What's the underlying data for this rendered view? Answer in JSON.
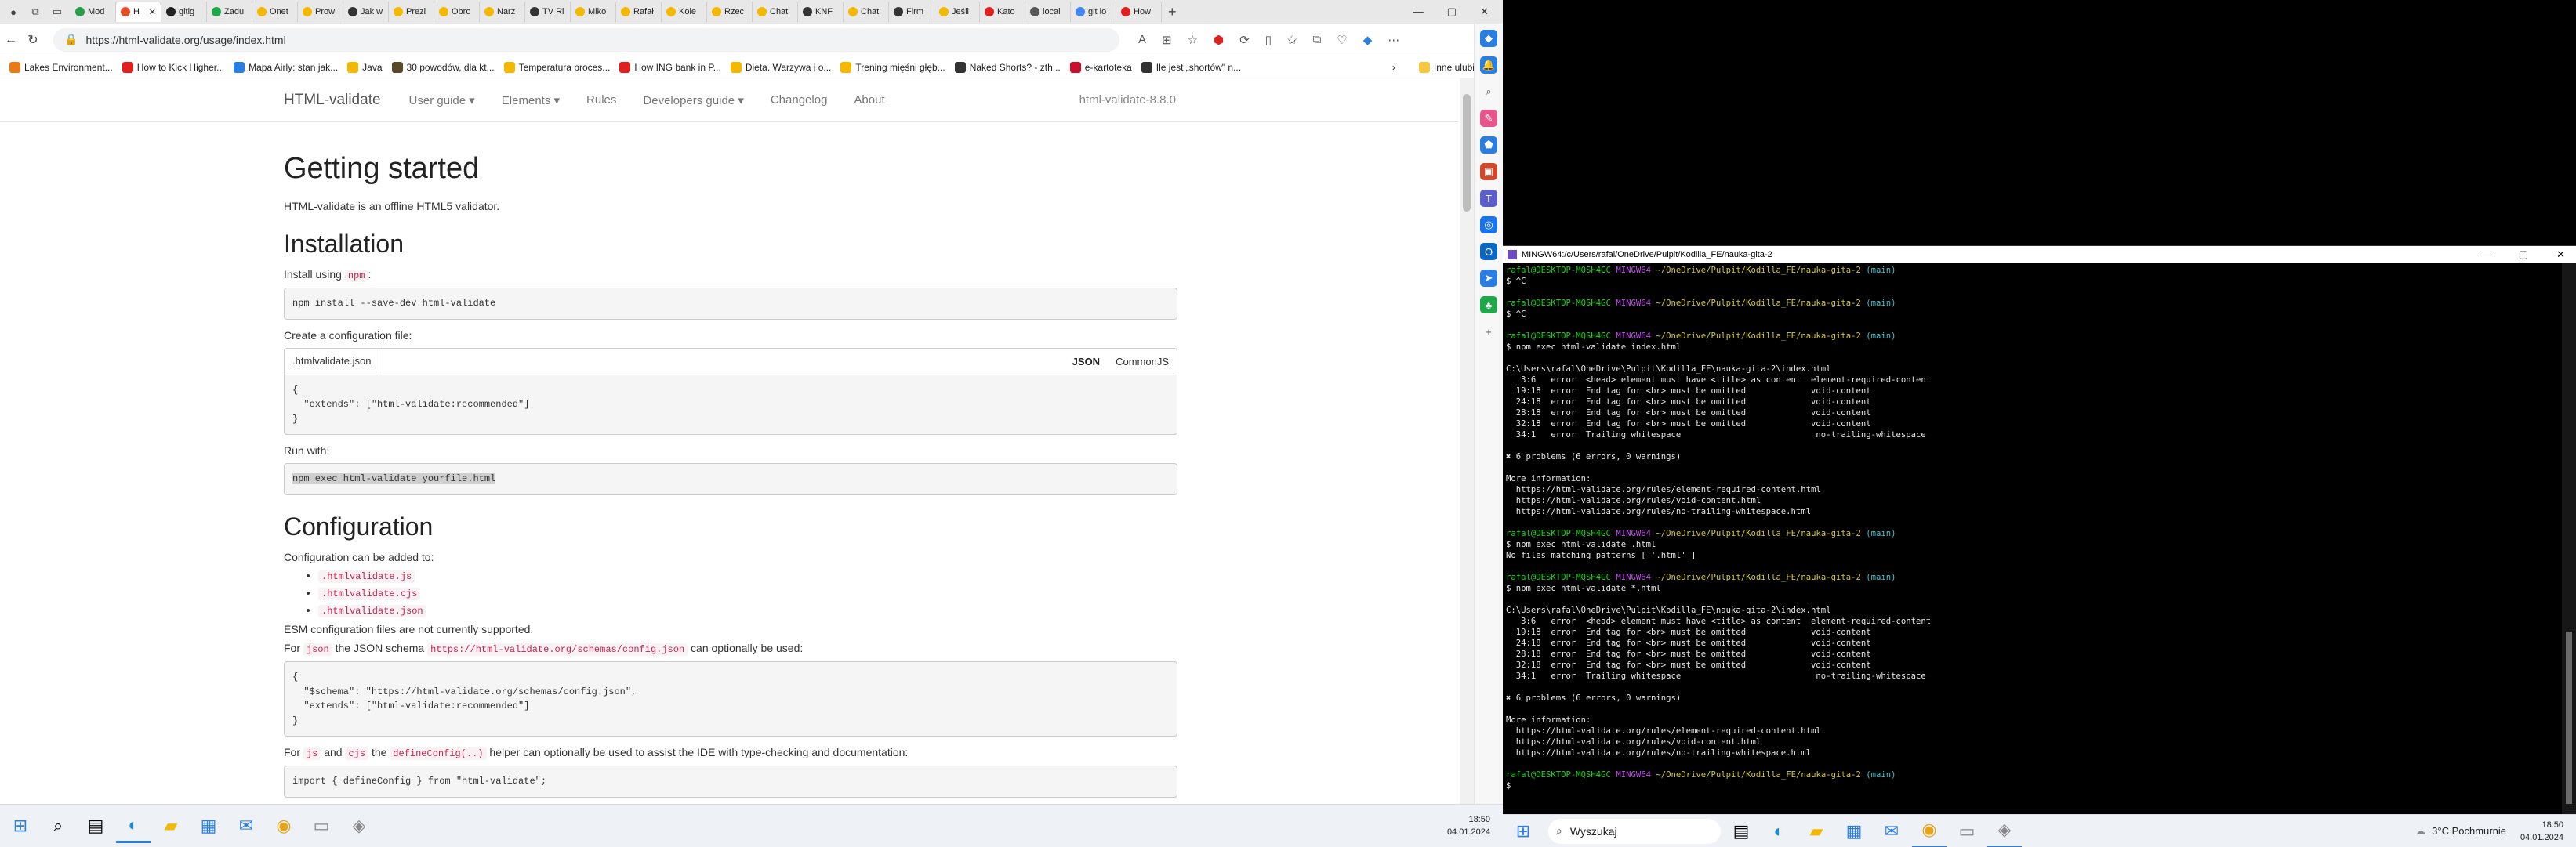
{
  "browser": {
    "tabs": [
      {
        "label": "Mod",
        "color": "#2a9d4a"
      },
      {
        "label": "H",
        "color": "#e44d26",
        "active": true
      },
      {
        "label": "gitig",
        "color": "#222"
      },
      {
        "label": "Zadu",
        "color": "#1fa84a"
      },
      {
        "label": "Onet",
        "color": "#f5b800"
      },
      {
        "label": "Prow",
        "color": "#f5b800"
      },
      {
        "label": "Jak w",
        "color": "#333"
      },
      {
        "label": "Prezi",
        "color": "#f5b800"
      },
      {
        "label": "Obro",
        "color": "#f5b800"
      },
      {
        "label": "Narz",
        "color": "#f5b800"
      },
      {
        "label": "TV Ri",
        "color": "#333"
      },
      {
        "label": "Miko",
        "color": "#f5b800"
      },
      {
        "label": "Rafał",
        "color": "#f5b800"
      },
      {
        "label": "Kole",
        "color": "#f5b800"
      },
      {
        "label": "Rzec",
        "color": "#f5b800"
      },
      {
        "label": "Chat",
        "color": "#f5b800"
      },
      {
        "label": "KNF",
        "color": "#333"
      },
      {
        "label": "Chat",
        "color": "#f5b800"
      },
      {
        "label": "Firm",
        "color": "#333"
      },
      {
        "label": "Jeśli",
        "color": "#f5b800"
      },
      {
        "label": "Kato",
        "color": "#e21f1f"
      },
      {
        "label": "local",
        "color": "#555"
      },
      {
        "label": "git lo",
        "color": "#4285f4"
      },
      {
        "label": "How",
        "color": "#e21f1f"
      }
    ],
    "new_tab_symbol": "+",
    "window_buttons": [
      "—",
      "▢",
      "✕"
    ],
    "url": "https://html-validate.org/usage/index.html",
    "bookmarks": [
      {
        "label": "Lakes Environment...",
        "color": "#e87b16"
      },
      {
        "label": "How to Kick Higher...",
        "color": "#e21f1f"
      },
      {
        "label": "Mapa Airly: stan jak...",
        "color": "#2a7de1"
      },
      {
        "label": "Java",
        "color": "#f5b800"
      },
      {
        "label": "30 powodów, dla kt...",
        "color": "#5a4a2a"
      },
      {
        "label": "Temperatura proces...",
        "color": "#f5b800"
      },
      {
        "label": "How ING bank in P...",
        "color": "#e21f1f"
      },
      {
        "label": "Dieta. Warzywa i o...",
        "color": "#f5b800"
      },
      {
        "label": "Trening mięśni głęb...",
        "color": "#f5b800"
      },
      {
        "label": "Naked Shorts? - zth...",
        "color": "#333"
      },
      {
        "label": "e-kartoteka",
        "color": "#c8102e"
      },
      {
        "label": "Ile jest „shortów\" n...",
        "color": "#333"
      }
    ],
    "bookmarks_more": "›",
    "bookmarks_folder": "Inne ulubione"
  },
  "site": {
    "brand": "HTML-validate",
    "nav": [
      "User guide",
      "Elements",
      "Rules",
      "Developers guide",
      "Changelog",
      "About"
    ],
    "version": "html-validate-8.8.0",
    "h1": "Getting started",
    "intro": "HTML-validate is an offline HTML5 validator.",
    "install_heading": "Installation",
    "install_using": "Install using",
    "npm": "npm",
    "install_cmd": "npm install --save-dev html-validate",
    "create_config": "Create a configuration file:",
    "config_filename": ".htmlvalidate.json",
    "config_tabs": [
      "JSON",
      "CommonJS"
    ],
    "config_code": "{\n  \"extends\": [\"html-validate:recommended\"]\n}",
    "run_with": "Run with:",
    "run_cmd": "npm exec html-validate yourfile.html",
    "config_heading": "Configuration",
    "config_added": "Configuration can be added to:",
    "config_files": [
      ".htmlvalidate.js",
      ".htmlvalidate.cjs",
      ".htmlvalidate.json"
    ],
    "esm_note": "ESM configuration files are not currently supported.",
    "for": "For",
    "json": "json",
    "json_schema_text": "the JSON schema",
    "schema_url": "https://html-validate.org/schemas/config.json",
    "optional_used": "can optionally be used:",
    "schema_code": "{\n  \"$schema\": \"https://html-validate.org/schemas/config.json\",\n  \"extends\": [\"html-validate:recommended\"]\n}",
    "js": "js",
    "and": "and",
    "cjs": "cjs",
    "the": "the",
    "define_config": "defineConfig(..)",
    "helper_text": "helper can optionally be used to assist the IDE with type-checking and documentation:",
    "import_code": "import { defineConfig } from \"html-validate\";"
  },
  "taskbar_left": {
    "time": "18:50",
    "date": "04.01.2024"
  },
  "terminal": {
    "title": "MINGW64:/c/Users/rafal/OneDrive/Pulpit/Kodilla_FE/nauka-gita-2",
    "prompt_user": "rafal@DESKTOP-MQSH4GC",
    "prompt_env": "MINGW64",
    "prompt_path": "~/OneDrive/Pulpit/Kodilla_FE/nauka-gita-2",
    "prompt_branch": "(main)",
    "lines": [
      {
        "t": "prompt"
      },
      {
        "t": "cmd",
        "text": "$ ^C"
      },
      {
        "t": "blank"
      },
      {
        "t": "prompt"
      },
      {
        "t": "cmd",
        "text": "$ ^C"
      },
      {
        "t": "blank"
      },
      {
        "t": "prompt"
      },
      {
        "t": "cmd",
        "text": "$ npm exec html-validate index.html"
      },
      {
        "t": "blank"
      },
      {
        "t": "out",
        "text": "C:\\Users\\rafal\\OneDrive\\Pulpit\\Kodilla_FE\\nauka-gita-2\\index.html"
      },
      {
        "t": "out",
        "text": "   3:6   error  <head> element must have <title> as content  element-required-content"
      },
      {
        "t": "out",
        "text": "  19:18  error  End tag for <br> must be omitted             void-content"
      },
      {
        "t": "out",
        "text": "  24:18  error  End tag for <br> must be omitted             void-content"
      },
      {
        "t": "out",
        "text": "  28:18  error  End tag for <br> must be omitted             void-content"
      },
      {
        "t": "out",
        "text": "  32:18  error  End tag for <br> must be omitted             void-content"
      },
      {
        "t": "out",
        "text": "  34:1   error  Trailing whitespace                           no-trailing-whitespace"
      },
      {
        "t": "blank"
      },
      {
        "t": "out",
        "text": "✖ 6 problems (6 errors, 0 warnings)"
      },
      {
        "t": "blank"
      },
      {
        "t": "out",
        "text": "More information:"
      },
      {
        "t": "out",
        "text": "  https://html-validate.org/rules/element-required-content.html"
      },
      {
        "t": "out",
        "text": "  https://html-validate.org/rules/void-content.html"
      },
      {
        "t": "out",
        "text": "  https://html-validate.org/rules/no-trailing-whitespace.html"
      },
      {
        "t": "blank"
      },
      {
        "t": "prompt"
      },
      {
        "t": "cmd",
        "text": "$ npm exec html-validate .html"
      },
      {
        "t": "out",
        "text": "No files matching patterns [ '.html' ]"
      },
      {
        "t": "blank"
      },
      {
        "t": "prompt"
      },
      {
        "t": "cmd",
        "text": "$ npm exec html-validate *.html"
      },
      {
        "t": "blank"
      },
      {
        "t": "out",
        "text": "C:\\Users\\rafal\\OneDrive\\Pulpit\\Kodilla_FE\\nauka-gita-2\\index.html"
      },
      {
        "t": "out",
        "text": "   3:6   error  <head> element must have <title> as content  element-required-content"
      },
      {
        "t": "out",
        "text": "  19:18  error  End tag for <br> must be omitted             void-content"
      },
      {
        "t": "out",
        "text": "  24:18  error  End tag for <br> must be omitted             void-content"
      },
      {
        "t": "out",
        "text": "  28:18  error  End tag for <br> must be omitted             void-content"
      },
      {
        "t": "out",
        "text": "  32:18  error  End tag for <br> must be omitted             void-content"
      },
      {
        "t": "out",
        "text": "  34:1   error  Trailing whitespace                           no-trailing-whitespace"
      },
      {
        "t": "blank"
      },
      {
        "t": "out",
        "text": "✖ 6 problems (6 errors, 0 warnings)"
      },
      {
        "t": "blank"
      },
      {
        "t": "out",
        "text": "More information:"
      },
      {
        "t": "out",
        "text": "  https://html-validate.org/rules/element-required-content.html"
      },
      {
        "t": "out",
        "text": "  https://html-validate.org/rules/void-content.html"
      },
      {
        "t": "out",
        "text": "  https://html-validate.org/rules/no-trailing-whitespace.html"
      },
      {
        "t": "blank"
      },
      {
        "t": "prompt"
      },
      {
        "t": "cmd",
        "text": "$ "
      }
    ]
  },
  "taskbar_right": {
    "search_label": "Wyszukaj",
    "weather": "3°C  Pochmurnie",
    "time": "18:50",
    "date": "04.01.2024"
  }
}
